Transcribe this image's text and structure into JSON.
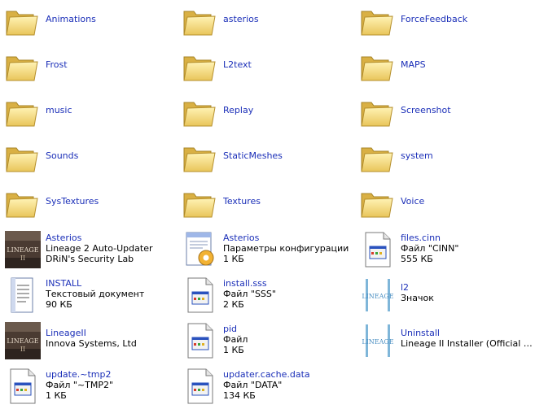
{
  "colors": {
    "background": "#ffffff",
    "name_text": "#1b2fb8",
    "detail_text": "#000000"
  },
  "items": [
    {
      "icon": "folder-icon",
      "lines": [
        "Animations"
      ]
    },
    {
      "icon": "folder-icon",
      "lines": [
        "asterios"
      ]
    },
    {
      "icon": "folder-icon",
      "lines": [
        "ForceFeedback"
      ]
    },
    {
      "icon": "folder-icon",
      "lines": [
        "Frost"
      ]
    },
    {
      "icon": "folder-icon",
      "lines": [
        "L2text"
      ]
    },
    {
      "icon": "folder-icon",
      "lines": [
        "MAPS"
      ]
    },
    {
      "icon": "folder-icon",
      "lines": [
        "music"
      ]
    },
    {
      "icon": "folder-icon",
      "lines": [
        "Replay"
      ]
    },
    {
      "icon": "folder-icon",
      "lines": [
        "Screenshot"
      ]
    },
    {
      "icon": "folder-icon",
      "lines": [
        "Sounds"
      ]
    },
    {
      "icon": "folder-icon",
      "lines": [
        "StaticMeshes"
      ]
    },
    {
      "icon": "folder-icon",
      "lines": [
        "system"
      ]
    },
    {
      "icon": "folder-icon",
      "lines": [
        "SysTextures"
      ]
    },
    {
      "icon": "folder-icon",
      "lines": [
        "Textures"
      ]
    },
    {
      "icon": "folder-icon",
      "lines": [
        "Voice"
      ]
    },
    {
      "icon": "lineage-exe-icon",
      "lines": [
        "Asterios",
        "Lineage 2 Auto-Updater",
        "DRiN's Security Lab"
      ]
    },
    {
      "icon": "config-file-icon",
      "lines": [
        "Asterios",
        "Параметры конфигурации",
        "1 КБ"
      ]
    },
    {
      "icon": "generic-file-icon",
      "lines": [
        "files.cinn",
        "Файл \"CINN\"",
        "555 КБ"
      ]
    },
    {
      "icon": "text-document-icon",
      "lines": [
        "INSTALL",
        "Текстовый документ",
        "90 КБ"
      ]
    },
    {
      "icon": "generic-file-icon",
      "lines": [
        "install.sss",
        "Файл \"SSS\"",
        "2 КБ"
      ]
    },
    {
      "icon": "lineage-logo-icon",
      "lines": [
        "l2",
        "Значок"
      ]
    },
    {
      "icon": "lineage-exe-icon",
      "lines": [
        "LineageII",
        "Innova Systems, Ltd"
      ]
    },
    {
      "icon": "generic-file-icon",
      "lines": [
        "pid",
        "Файл",
        "1 КБ"
      ]
    },
    {
      "icon": "lineage-logo-icon",
      "lines": [
        "Uninstall",
        "Lineage II Installer (Official Ru..."
      ]
    },
    {
      "icon": "generic-file-icon",
      "lines": [
        "update.~tmp2",
        "Файл \"~TMP2\"",
        "1 КБ"
      ]
    },
    {
      "icon": "generic-file-icon",
      "lines": [
        "updater.cache.data",
        "Файл \"DATA\"",
        "134 КБ"
      ]
    }
  ]
}
